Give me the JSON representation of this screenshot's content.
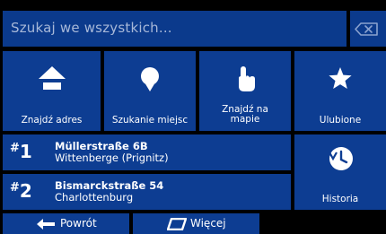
{
  "search": {
    "placeholder": "Szukaj we wszystkich...",
    "clear_icon": "backspace-icon"
  },
  "menu": [
    {
      "label": "Znajdź adres",
      "icon": "home-icon"
    },
    {
      "label": "Szukanie miejsc",
      "icon": "place-pin-icon"
    },
    {
      "label_line1": "Znajdź na",
      "label_line2": "mapie",
      "icon": "hand-pointer-icon"
    },
    {
      "label": "Ulubione",
      "icon": "star-icon"
    }
  ],
  "recent": [
    {
      "hash": "#",
      "number": "1",
      "street": "Müllerstraße 6B",
      "city": "Wittenberge (Prignitz)"
    },
    {
      "hash": "#",
      "number": "2",
      "street": "Bismarckstraße 54",
      "city": "Charlottenburg"
    }
  ],
  "history": {
    "label": "Historia",
    "icon": "history-clock-icon"
  },
  "bottom": {
    "back_label": "Powrót",
    "back_icon": "arrow-left-icon",
    "more_label": "Więcej",
    "more_icon": "more-icon"
  },
  "colors": {
    "tile": "#0d3d92",
    "background": "#000000",
    "text": "#ffffff",
    "placeholder": "#a7b8d8"
  }
}
